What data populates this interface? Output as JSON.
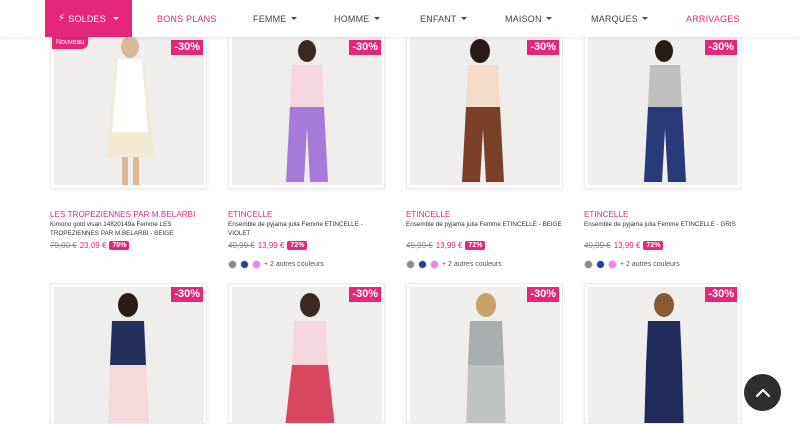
{
  "nav": {
    "soldes": "SOLDES",
    "bons_plans": "BONS PLANS",
    "femme": "FEMME",
    "homme": "HOMME",
    "enfant": "ENFANT",
    "maison": "MAISON",
    "marques": "MARQUES",
    "arrivages": "ARRIVAGES"
  },
  "colors": {
    "accent": "#e5277b",
    "text": "#333333",
    "muted": "#888888"
  },
  "products": [
    {
      "badge_new": "Nouveau",
      "discount": "-30%",
      "brand": "LES TROPEZIENNES PAR M.BELARBI",
      "title": "Kimono gold visan 14820149a Femme LES TROPEZIENNES PAR M.BELARBI - BEIGE",
      "old_price": "79,00 €",
      "new_price": "23,09 €",
      "pct": "70%"
    },
    {
      "discount": "-30%",
      "brand": "ETINCELLE",
      "title": "Ensemble de pyjama julia Femme ETINCELLE - VIOLET",
      "old_price": "49,99 €",
      "new_price": "13,99 €",
      "pct": "72%",
      "more_colors": "+ 2 autres couleurs"
    },
    {
      "discount": "-30%",
      "brand": "ETINCELLE",
      "title": "Ensemble de pyjama julia Femme ETINCELLE - BEIGE",
      "old_price": "49,99 €",
      "new_price": "13,99 €",
      "pct": "72%",
      "more_colors": "+ 2 autres couleurs"
    },
    {
      "discount": "-30%",
      "brand": "ETINCELLE",
      "title": "Ensemble de pyjama julia Femme ETINCELLE - GRIS",
      "old_price": "49,99 €",
      "new_price": "13,99 €",
      "pct": "72%",
      "more_colors": "+ 2 autres couleurs"
    },
    {
      "discount": "-30%"
    },
    {
      "discount": "-30%"
    },
    {
      "discount": "-30%"
    },
    {
      "discount": "-30%"
    }
  ],
  "swatch_colors": [
    "#8a8a8a",
    "#2a3f8f",
    "#ee82ee"
  ],
  "icons": {
    "soldes": "bolt-icon",
    "scroll_top": "chevron-up-icon"
  }
}
